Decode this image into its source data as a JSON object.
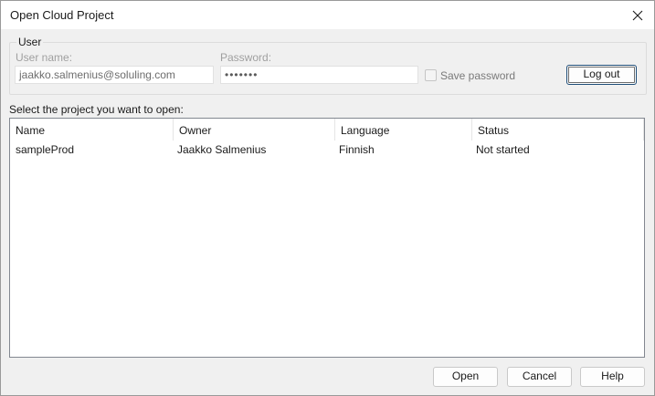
{
  "window": {
    "title": "Open Cloud Project",
    "close_icon": "close-icon"
  },
  "user_group": {
    "legend": "User",
    "username_label": "User name:",
    "username_value": "jaakko.salmenius@soluling.com",
    "password_label": "Password:",
    "password_value": "•••••••",
    "save_password_label": "Save password",
    "save_password_checked": false,
    "logout_label": "Log out"
  },
  "project_list": {
    "label": "Select the project you want to open:",
    "columns": [
      "Name",
      "Owner",
      "Language",
      "Status"
    ],
    "rows": [
      [
        "sampleProd",
        "Jaakko Salmenius",
        "Finnish",
        "Not started"
      ]
    ]
  },
  "buttons": {
    "open": "Open",
    "cancel": "Cancel",
    "help": "Help"
  }
}
